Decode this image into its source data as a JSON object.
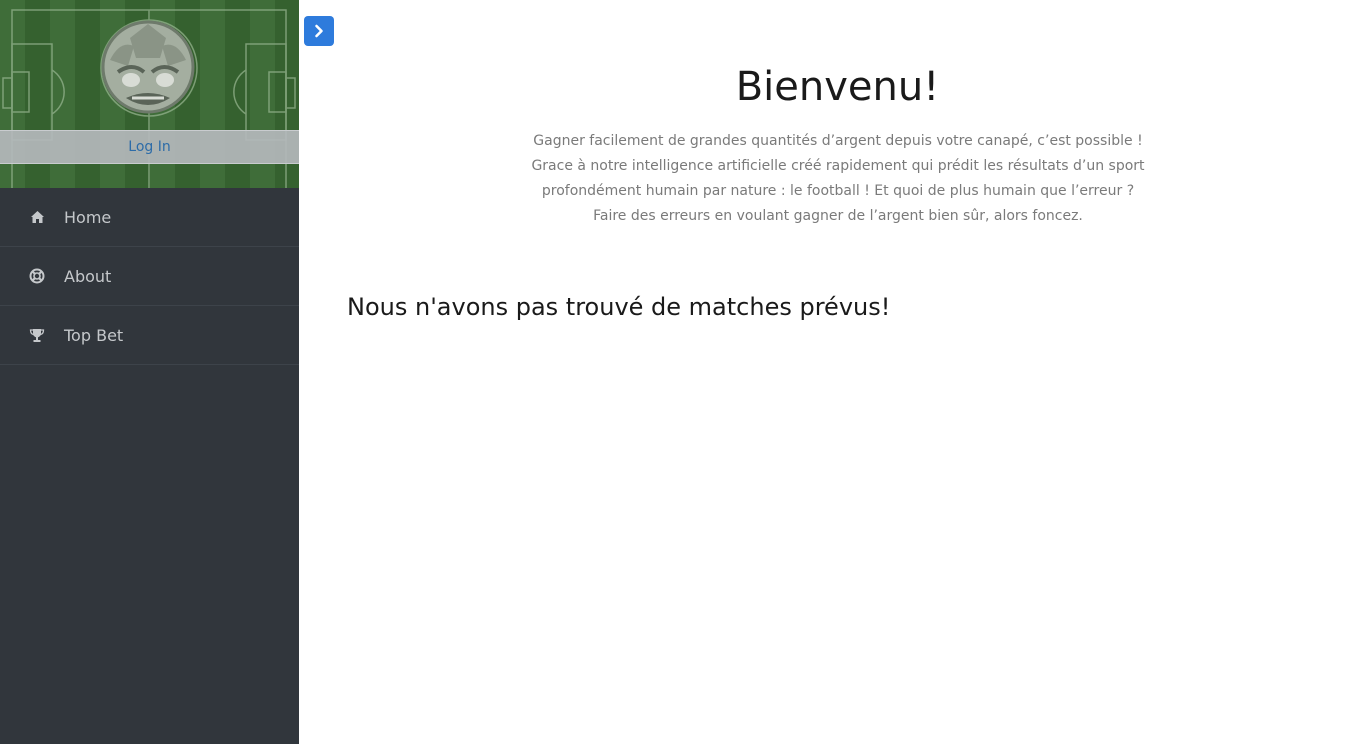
{
  "sidebar": {
    "login_label": "Log In",
    "items": [
      {
        "label": "Home",
        "icon": "home-icon"
      },
      {
        "label": "About",
        "icon": "lifebuoy-icon"
      },
      {
        "label": "Top Bet",
        "icon": "trophy-icon"
      }
    ]
  },
  "toggle": {
    "icon": "chevron-right-icon"
  },
  "main": {
    "title": "Bienvenu!",
    "intro": "Gagner facilement de grandes quantités d’argent depuis votre canapé, c’est possible ! Grace à notre intelligence artificielle créé rapidement qui prédit les résultats d’un sport profondément humain par nature : le football ! Et quoi de plus humain que l’erreur ? Faire des erreurs en voulant gagner de l’argent bien sûr, alors foncez.",
    "no_matches": "Nous n'avons pas trouvé de matches prévus!"
  },
  "colors": {
    "sidebar_bg": "#31363c",
    "pitch_green": "#3f6d39",
    "toggle_blue": "#2e7bdc",
    "link_blue": "#2d6ca8"
  }
}
